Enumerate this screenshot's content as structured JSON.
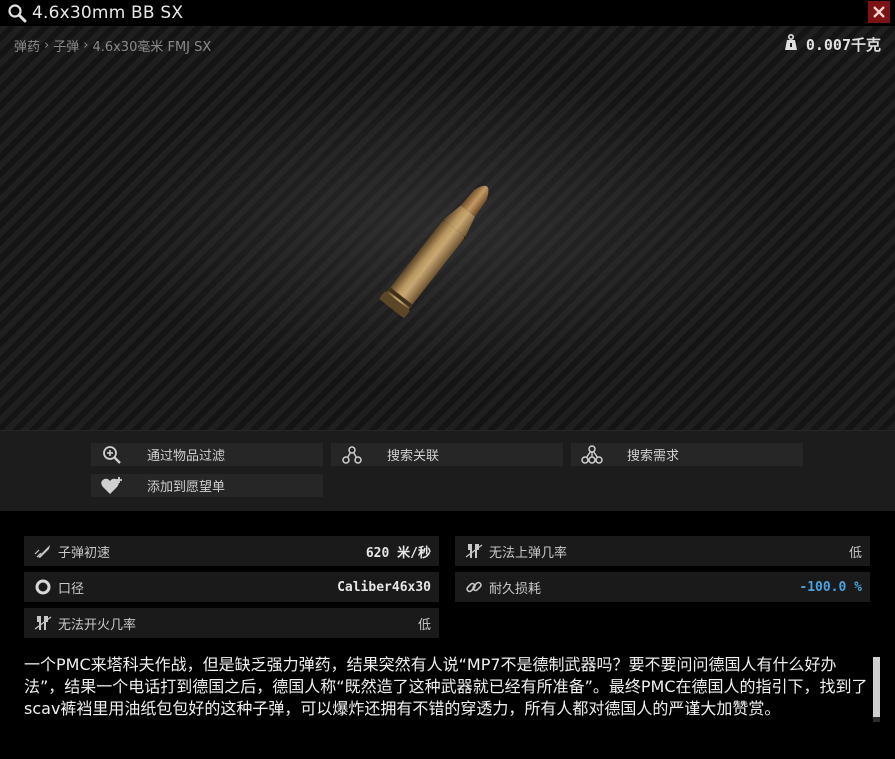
{
  "window": {
    "title": "4.6x30mm BB SX",
    "search_icon": "magnifier-icon",
    "close_icon": "close-x-icon"
  },
  "viewer": {
    "breadcrumb": [
      "弹药",
      "子弹",
      "4.6x30毫米 FMJ SX"
    ],
    "breadcrumb_sep": "›",
    "weight": "0.007千克",
    "weight_icon": "weight-icon",
    "item_image": "bullet-cartridge"
  },
  "actions": {
    "filter_by_item": "通过物品过滤",
    "linked_search": "搜索关联",
    "required_search": "搜索需求",
    "add_to_wishlist": "添加到愿望单"
  },
  "stats": {
    "velocity": {
      "label": "子弹初速",
      "value": "620 米/秒",
      "icon": "velocity-icon"
    },
    "caliber": {
      "label": "口径",
      "value": "Caliber46x30",
      "icon": "caliber-ring-icon"
    },
    "misfire": {
      "label": "无法开火几率",
      "value": "低",
      "icon": "misfire-icon"
    },
    "feed_failure": {
      "label": "无法上弹几率",
      "value": "低",
      "icon": "misfeed-icon"
    },
    "durability_burn": {
      "label": "耐久损耗",
      "value": "-100.0 %",
      "icon": "chain-link-icon"
    }
  },
  "colors": {
    "accent_blue": "#4aa3df",
    "close_red": "#7a1414"
  },
  "description": {
    "text": "一个PMC来塔科夫作战，但是缺乏强力弹药，结果突然有人说“MP7不是德制武器吗？要不要问问德国人有什么好办法”，结果一个电话打到德国之后，德国人称“既然造了这种武器就已经有所准备”。最终PMC在德国人的指引下，找到了scav裤裆里用油纸包包好的这种子弹，可以爆炸还拥有不错的穿透力，所有人都对德国人的严谨大加赞赏。"
  }
}
